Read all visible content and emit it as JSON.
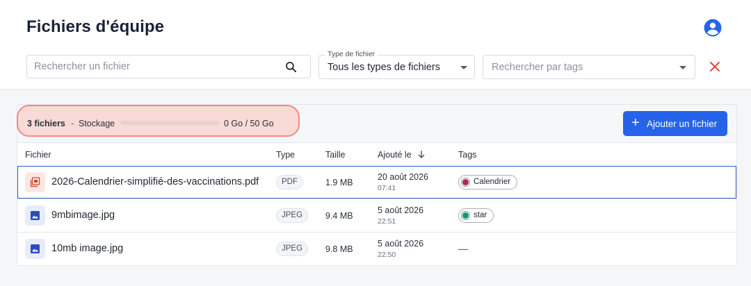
{
  "header": {
    "title": "Fichiers d'équipe",
    "avatar_icon": "account-circle-icon"
  },
  "filters": {
    "search_placeholder": "Rechercher un fichier",
    "type_label": "Type de fichier",
    "type_value": "Tous les types de fichiers",
    "tags_placeholder": "Rechercher par tags",
    "clear_icon": "close-icon",
    "clear_color": "#e0463a"
  },
  "storage": {
    "count": "3 fichiers",
    "separator": "-",
    "label": "Stockage",
    "amount": "0 Go / 50 Go",
    "used_fraction": 0.0
  },
  "actions": {
    "add_label": "Ajouter un fichier",
    "add_icon": "plus-icon",
    "accent": "#2563eb"
  },
  "table": {
    "headers": {
      "file": "Fichier",
      "type": "Type",
      "size": "Taille",
      "added": "Ajouté le",
      "tags": "Tags"
    },
    "rows": [
      {
        "icon": "pdf-file-icon",
        "name": "2026-Calendrier-simplifié-des-vaccinations.pdf",
        "type": "PDF",
        "size": "1.9 MB",
        "date": "20 août 2026",
        "time": "07:41",
        "tag": "Calendrier",
        "tag_color": "#b3244f",
        "selected": true
      },
      {
        "icon": "image-file-icon",
        "name": "9mbimage.jpg",
        "type": "JPEG",
        "size": "9.4 MB",
        "date": "5 août 2026",
        "time": "22:51",
        "tag": "star",
        "tag_color": "#14966f",
        "selected": false
      },
      {
        "icon": "image-file-icon",
        "name": "10mb image.jpg",
        "type": "JPEG",
        "size": "9.8 MB",
        "date": "5 août 2026",
        "time": "22:50",
        "tag": "—",
        "selected": false
      }
    ]
  }
}
